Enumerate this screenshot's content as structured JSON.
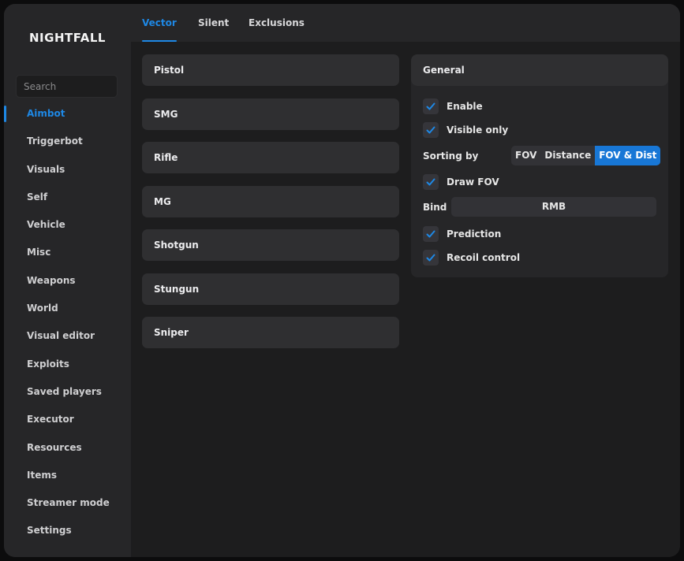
{
  "app": {
    "title": "NIGHTFALL"
  },
  "search": {
    "placeholder": "Search"
  },
  "sidebar": {
    "items": [
      {
        "label": "Aimbot",
        "active": true
      },
      {
        "label": "Triggerbot"
      },
      {
        "label": "Visuals"
      },
      {
        "label": "Self"
      },
      {
        "label": "Vehicle"
      },
      {
        "label": "Misc"
      },
      {
        "label": "Weapons"
      },
      {
        "label": "World"
      },
      {
        "label": "Visual editor"
      },
      {
        "label": "Exploits"
      },
      {
        "label": "Saved players"
      },
      {
        "label": "Executor"
      },
      {
        "label": "Resources"
      },
      {
        "label": "Items"
      },
      {
        "label": "Streamer mode"
      },
      {
        "label": "Settings"
      }
    ]
  },
  "tabs": [
    {
      "label": "Vector",
      "active": true
    },
    {
      "label": "Silent"
    },
    {
      "label": "Exclusions"
    }
  ],
  "weapons": [
    "Pistol",
    "SMG",
    "Rifle",
    "MG",
    "Shotgun",
    "Stungun",
    "Sniper"
  ],
  "general": {
    "title": "General",
    "enable": {
      "label": "Enable",
      "checked": true
    },
    "visible_only": {
      "label": "Visible only",
      "checked": true
    },
    "sorting": {
      "label": "Sorting by",
      "options": [
        "FOV",
        "Distance",
        "FOV & Dist"
      ],
      "selected": "FOV & Dist"
    },
    "draw_fov": {
      "label": "Draw FOV",
      "checked": true
    },
    "bind": {
      "label": "Bind",
      "value": "RMB"
    },
    "prediction": {
      "label": "Prediction",
      "checked": true
    },
    "recoil": {
      "label": "Recoil control",
      "checked": true
    }
  },
  "colors": {
    "accent": "#1e88e5",
    "selected_segment": "#1877d6",
    "background": "#1d1d1e",
    "sidebar": "#262628"
  }
}
